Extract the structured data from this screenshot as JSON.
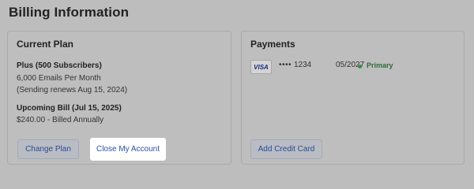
{
  "page": {
    "title": "Billing Information"
  },
  "plan": {
    "title": "Current Plan",
    "name": "Plus (500 Subscribers)",
    "emails": "6,000 Emails Per Month",
    "renewal": "(Sending renews Aug 15, 2024)",
    "upcoming_title": "Upcoming Bill (Jul 15, 2025)",
    "upcoming_amount": "$240.00 - Billed Annually",
    "change_label": "Change Plan",
    "close_label": "Close My Account"
  },
  "payments": {
    "title": "Payments",
    "card": {
      "brand": "VISA",
      "mask": "••••",
      "last4": "1234",
      "expiry": "05/2027",
      "status": "Primary",
      "status_color": "#3a8c4a"
    },
    "add_label": "Add Credit Card"
  },
  "colors": {
    "background": "#bdbdbd",
    "link": "#2a4c96"
  }
}
